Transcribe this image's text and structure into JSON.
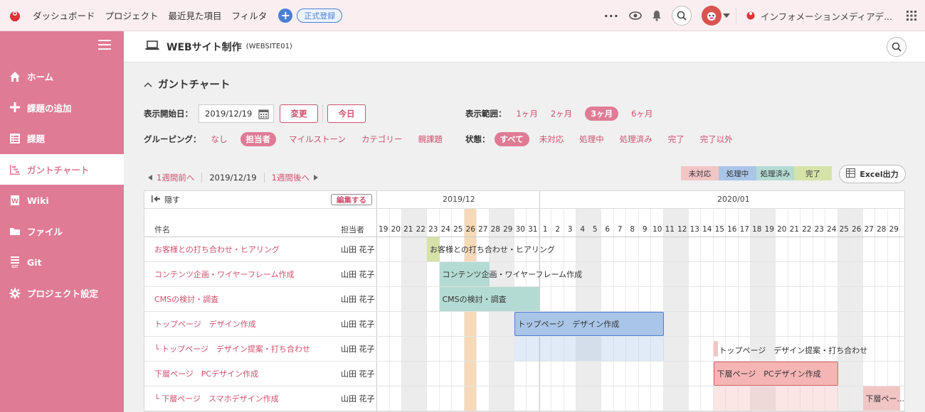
{
  "colors": {
    "accent": "#e07b95",
    "link": "#d0506e",
    "blue": "#4a7fd6"
  },
  "topbar": {
    "nav": [
      "ダッシュボード",
      "プロジェクト",
      "最近見た項目",
      "フィルタ"
    ],
    "register": "正式登録",
    "space_name": "インフォメーションメディアデ..."
  },
  "sidebar": {
    "items": [
      {
        "label": "ホーム",
        "icon": "home-icon"
      },
      {
        "label": "課題の追加",
        "icon": "plus-icon"
      },
      {
        "label": "課題",
        "icon": "list-icon"
      },
      {
        "label": "ガントチャート",
        "icon": "gantt-icon"
      },
      {
        "label": "Wiki",
        "icon": "wiki-icon"
      },
      {
        "label": "ファイル",
        "icon": "folder-icon"
      },
      {
        "label": "Git",
        "icon": "git-icon"
      },
      {
        "label": "プロジェクト設定",
        "icon": "gear-icon"
      }
    ]
  },
  "project": {
    "title": "WEBサイト制作",
    "key": "(WEBSITE01)"
  },
  "section_title": "ガントチャート",
  "controls": {
    "start_label": "表示開始日：",
    "start_value": "2019/12/19",
    "change_btn": "変更",
    "today_btn": "今日",
    "range_label": "表示範囲：",
    "ranges": [
      "1ヶ月",
      "2ヶ月",
      "3ヶ月",
      "6ヶ月"
    ],
    "range_active": "3ヶ月",
    "group_label": "グルーピング：",
    "groups": [
      "なし",
      "担当者",
      "マイルストーン",
      "カテゴリー",
      "親課題"
    ],
    "group_active": "担当者",
    "status_label": "状態：",
    "statuses": [
      "すべて",
      "未対応",
      "処理中",
      "処理済み",
      "完了",
      "完了以外"
    ],
    "status_active": "すべて"
  },
  "weeknav": {
    "prev": "1週間前へ",
    "current": "2019/12/19",
    "next": "1週間後へ"
  },
  "legend": [
    {
      "label": "未対応",
      "color": "#f2c5c5"
    },
    {
      "label": "処理中",
      "color": "#a9c5e8"
    },
    {
      "label": "処理済み",
      "color": "#b4dbd3"
    },
    {
      "label": "完了",
      "color": "#d6e3a8"
    }
  ],
  "excel_btn": "Excel出力",
  "gantt": {
    "hide": "隠す",
    "edit": "編集する",
    "col_name": "件名",
    "col_person": "担当者",
    "months": [
      "2019/12",
      "2020/01"
    ],
    "days": [
      19,
      20,
      21,
      22,
      23,
      24,
      25,
      26,
      27,
      28,
      29,
      30,
      31,
      1,
      2,
      3,
      4,
      5,
      6,
      7,
      8,
      9,
      10,
      11,
      12,
      13,
      14,
      15,
      16,
      17,
      18,
      19,
      20,
      21,
      22,
      23,
      24,
      25,
      26,
      27,
      28,
      29
    ],
    "weekend_cols": [
      2,
      3,
      9,
      10,
      16,
      17,
      23,
      24,
      30,
      31,
      37,
      38
    ],
    "today_col": 7,
    "rows": [
      {
        "name": "お客様との打ち合わせ・ヒアリング",
        "person": "山田 花子",
        "sub": false
      },
      {
        "name": "コンテンツ企画・ワイヤーフレーム作成",
        "person": "山田 花子",
        "sub": false
      },
      {
        "name": "CMSの検討・調査",
        "person": "山田 花子",
        "sub": false
      },
      {
        "name": "トップページ　デザイン作成",
        "person": "山田 花子",
        "sub": false
      },
      {
        "name": "トップページ　デザイン提案・打ち合わせ",
        "person": "山田 花子",
        "sub": true
      },
      {
        "name": "下層ページ　PCデザイン作成",
        "person": "山田 花子",
        "sub": false
      },
      {
        "name": "下層ページ　スマホデザイン作成",
        "person": "山田 花子",
        "sub": true
      }
    ],
    "bars": [
      {
        "row": 0,
        "start": 4,
        "end": 4,
        "color": "#d6e3a8",
        "label": "お客様との打ち合わせ・ヒアリング"
      },
      {
        "row": 1,
        "start": 5,
        "end": 8,
        "color": "#b4dbd3",
        "label": "コンテンツ企画・ワイヤーフレーム作成"
      },
      {
        "row": 2,
        "start": 5,
        "end": 12,
        "color": "#b4dbd3",
        "label": "CMSの検討・調査"
      },
      {
        "row": 3,
        "start": 11,
        "end": 22,
        "color": "#a9c5e8",
        "label": "トップページ　デザイン作成",
        "parent": true,
        "border": "#4a7fd6"
      },
      {
        "row": 4,
        "start": 27,
        "end": 27,
        "color": "#f2c5c5",
        "label": "トップページ　デザイン提案・打ち合わせ",
        "thin": true
      },
      {
        "row": 5,
        "start": 27,
        "end": 36,
        "color": "#f5b5b5",
        "label": "下層ページ　PCデザイン作成",
        "parent": true,
        "border": "#e06060"
      },
      {
        "row": 6,
        "start": 39,
        "end": 41,
        "color": "#f2c5c5",
        "label": "下層ペー..."
      }
    ]
  }
}
